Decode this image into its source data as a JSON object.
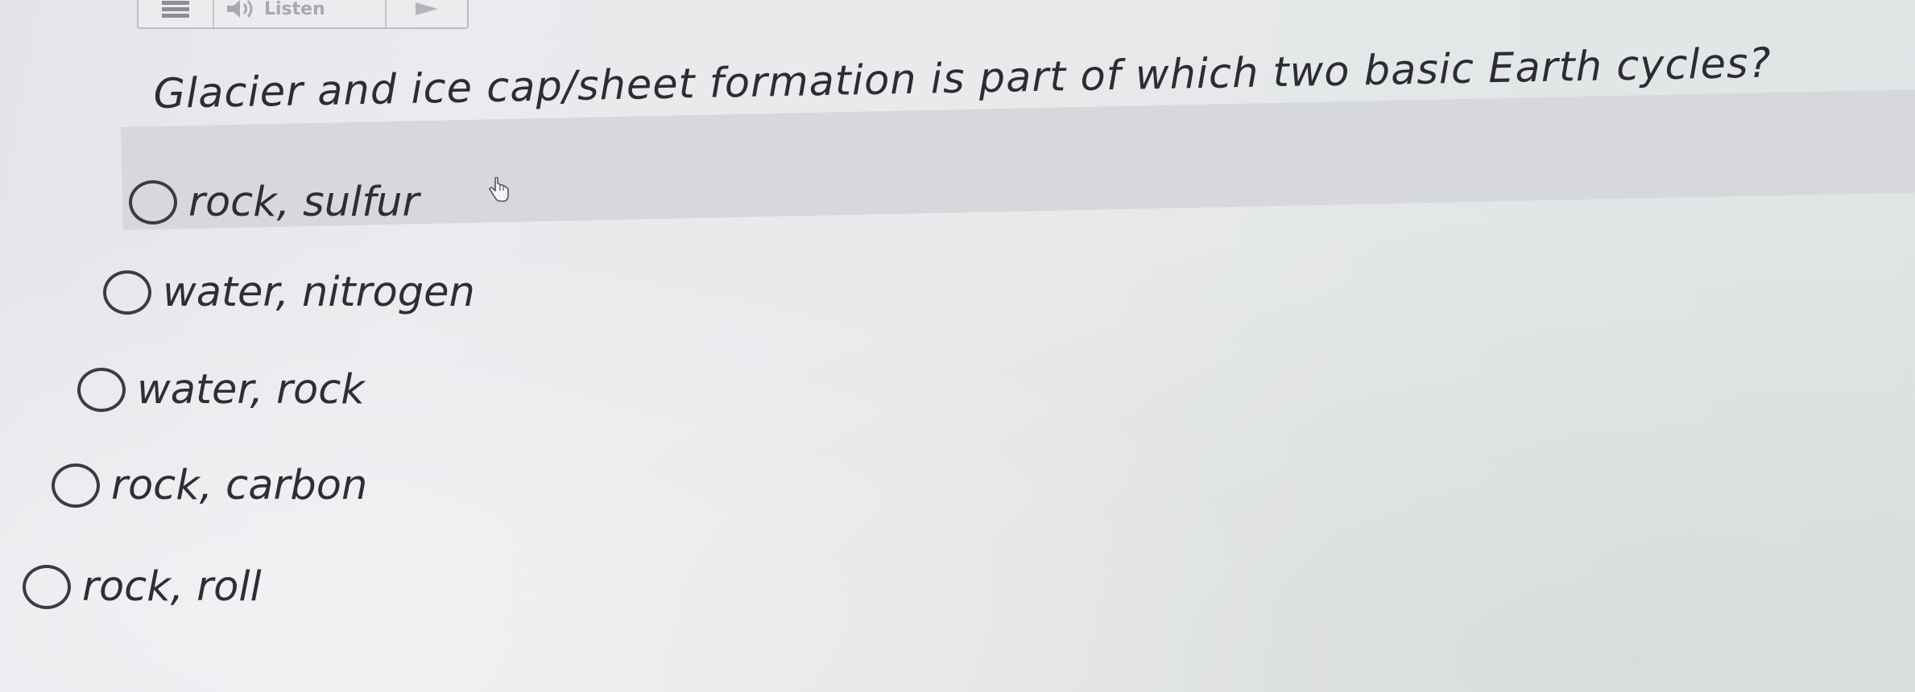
{
  "toolbar": {
    "listen_label": "Listen",
    "menu_icon": "hamburger-menu-icon",
    "speaker_icon": "speaker-icon",
    "more_icon": "play-arrow-icon"
  },
  "question": {
    "text": "Glacier and ice cap/sheet formation is part of which two basic Earth cycles?"
  },
  "options": [
    {
      "label": "rock, sulfur",
      "highlighted": true
    },
    {
      "label": "water, nitrogen",
      "highlighted": false
    },
    {
      "label": "water, rock",
      "highlighted": false
    },
    {
      "label": "rock, carbon",
      "highlighted": false
    },
    {
      "label": "rock, roll",
      "highlighted": false
    }
  ],
  "colors": {
    "background": "#e9e9ec",
    "highlight": "#d6d8db",
    "text": "#2f2e35"
  }
}
